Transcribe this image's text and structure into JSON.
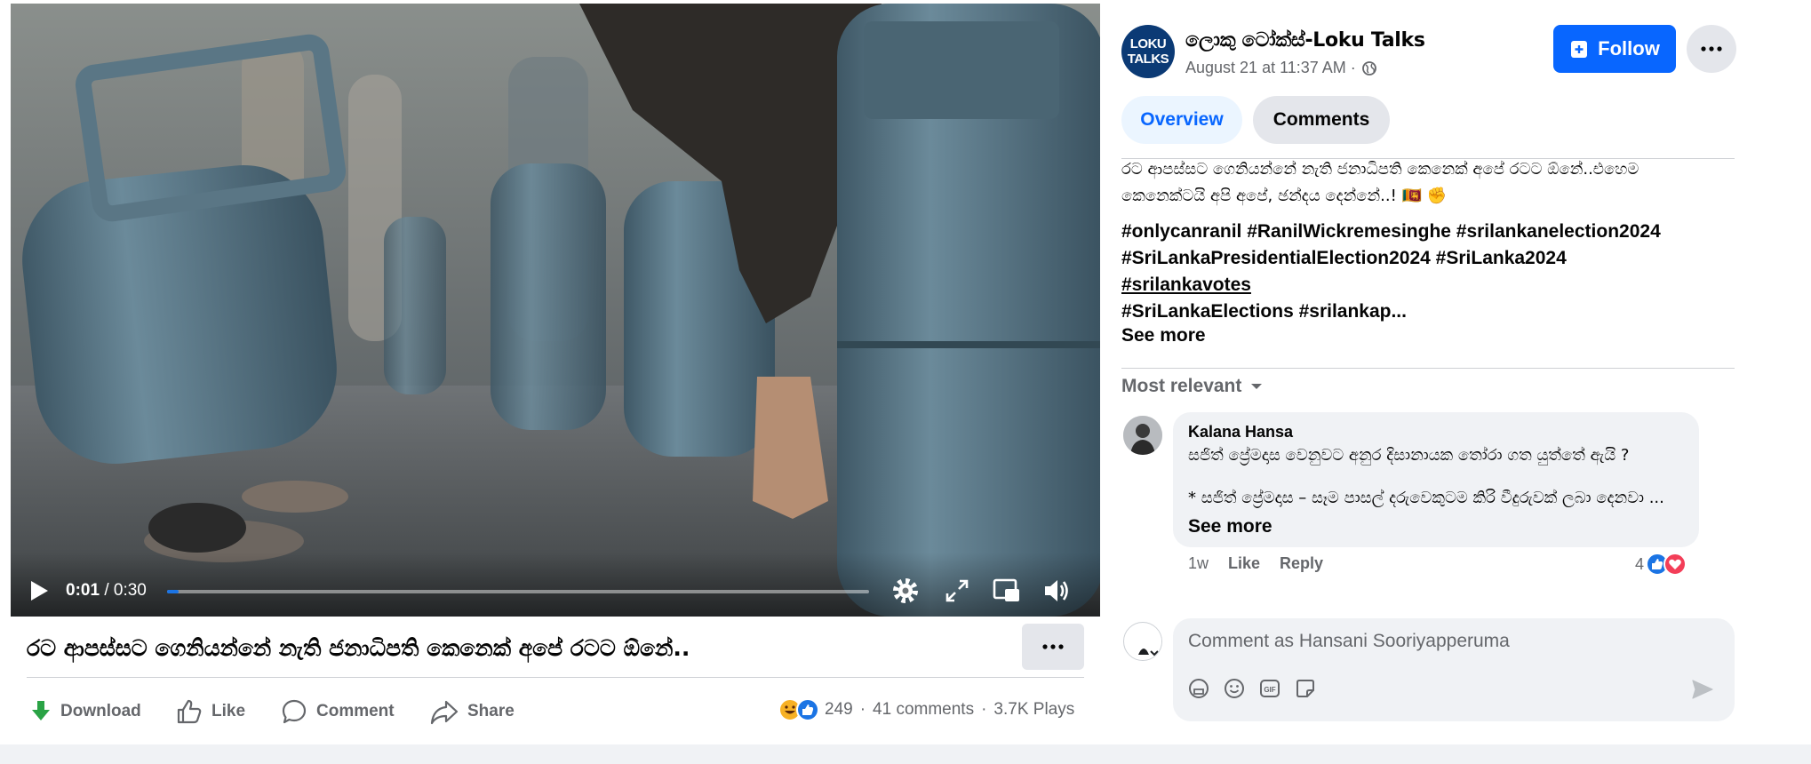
{
  "video": {
    "current_time": "0:01",
    "separator": "/",
    "duration": "0:30",
    "progress_fraction": 0.017
  },
  "post": {
    "title": "රට ආපස්සට ගෙනියන්නේ නැති ජනාධිපති කෙනෙක් අපේ රටට ඕනේ..",
    "more_icon": "ellipsis-icon"
  },
  "actions": {
    "download": "Download",
    "like": "Like",
    "comment": "Comment",
    "share": "Share"
  },
  "stats": {
    "reactions": "249",
    "comments": "41 comments",
    "plays": "3.7K Plays",
    "dot": "·"
  },
  "page": {
    "logo_line1": "LOKU",
    "logo_line2": "TALKS",
    "name": "ලොකු ටෝක්ස්-Loku Talks",
    "time": "August 21 at 11:37 AM ·",
    "follow_label": "Follow"
  },
  "tabs": {
    "overview": "Overview",
    "comments": "Comments"
  },
  "caption": {
    "text_line1": "රට ආපස්සට ගෙනියන්නේ නැති ජනාධිපති කෙනෙක් අපේ රටට ඕනේ..එහෙම",
    "text_line2": "කෙනෙක්ටයි අපි අපේ, ඡන්දය දෙන්නේ..! 🇱🇰 ✊",
    "hashtag_line1": "#onlycanranil #RanilWickremesinghe #srilankanelection2024",
    "hashtag_line2": "#SriLankaPresidentialElection2024 #SriLanka2024",
    "hashtag_line3": "#srilankavotes",
    "hashtag_line4": "#SriLankaElections #srilankap...",
    "see_more": "See more"
  },
  "comments_section": {
    "sort_label": "Most relevant",
    "comment": {
      "author": "Kalana Hansa",
      "line1": "සජිත් ප්‍රේමදාස වෙනුවට අනුර දිසානායක තෝරා ගත යුත්තේ ඇයි ?",
      "line2": "* සජිත් ප්‍රේමදාස – සෑම පාසල් දරුවෙකුටම කිරි වීදුරුවක් ලබා දෙනවා ...",
      "see_more": "See more",
      "time": "1w",
      "like": "Like",
      "reply": "Reply",
      "reaction_count": "4"
    },
    "composer_placeholder": "Comment as Hansani Sooriyapperuma"
  },
  "colors": {
    "accent": "#0866ff",
    "muted": "#65676b",
    "download_green": "#2aa345"
  }
}
